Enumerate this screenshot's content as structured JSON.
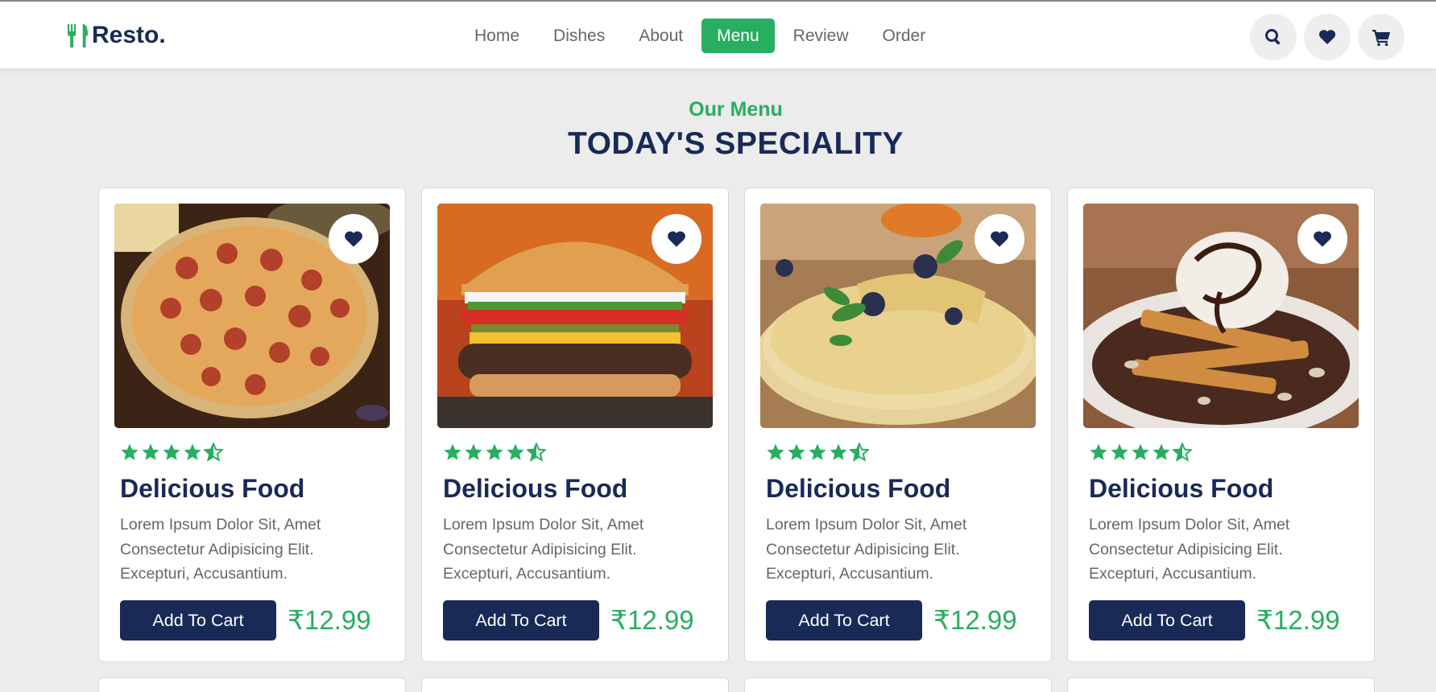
{
  "brand": {
    "name": "Resto."
  },
  "nav": {
    "items": [
      {
        "label": "Home",
        "active": false
      },
      {
        "label": "Dishes",
        "active": false
      },
      {
        "label": "About",
        "active": false
      },
      {
        "label": "Menu",
        "active": true
      },
      {
        "label": "Review",
        "active": false
      },
      {
        "label": "Order",
        "active": false
      }
    ]
  },
  "header_icons": [
    "search-icon",
    "heart-icon",
    "cart-icon"
  ],
  "section": {
    "sub_heading": "Our Menu",
    "heading": "TODAY'S SPECIALITY"
  },
  "colors": {
    "accent": "#27ae60",
    "dark": "#192a56",
    "text": "#666666",
    "background": "#ececec"
  },
  "cards": [
    {
      "image": "pepperoni-pizza",
      "rating": 4.5,
      "title": "Delicious Food",
      "description": "Lorem Ipsum Dolor Sit, Amet Consectetur Adipisicing Elit. Excepturi, Accusantium.",
      "button": "Add To Cart",
      "price": "₹12.99"
    },
    {
      "image": "cheeseburger",
      "rating": 4.5,
      "title": "Delicious Food",
      "description": "Lorem Ipsum Dolor Sit, Amet Consectetur Adipisicing Elit. Excepturi, Accusantium.",
      "button": "Add To Cart",
      "price": "₹12.99"
    },
    {
      "image": "crepes-with-berries",
      "rating": 4.5,
      "title": "Delicious Food",
      "description": "Lorem Ipsum Dolor Sit, Amet Consectetur Adipisicing Elit. Excepturi, Accusantium.",
      "button": "Add To Cart",
      "price": "₹12.99"
    },
    {
      "image": "waffle-ice-cream",
      "rating": 4.5,
      "title": "Delicious Food",
      "description": "Lorem Ipsum Dolor Sit, Amet Consectetur Adipisicing Elit. Excepturi, Accusantium.",
      "button": "Add To Cart",
      "price": "₹12.99"
    }
  ]
}
